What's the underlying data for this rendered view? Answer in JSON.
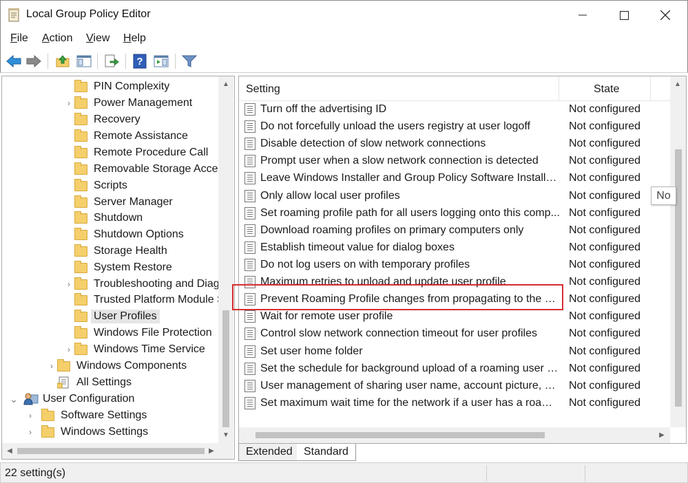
{
  "window": {
    "title": "Local Group Policy Editor"
  },
  "menu": {
    "items": [
      {
        "key": "F",
        "rest": "ile"
      },
      {
        "key": "A",
        "rest": "ction"
      },
      {
        "key": "V",
        "rest": "iew"
      },
      {
        "key": "H",
        "rest": "elp"
      }
    ]
  },
  "tree": {
    "items": [
      {
        "label": "PIN Complexity",
        "expander": false,
        "icon": "folder-icon"
      },
      {
        "label": "Power Management",
        "expander": true,
        "icon": "folder-icon"
      },
      {
        "label": "Recovery",
        "expander": false,
        "icon": "folder-icon"
      },
      {
        "label": "Remote Assistance",
        "expander": false,
        "icon": "folder-icon"
      },
      {
        "label": "Remote Procedure Call",
        "expander": false,
        "icon": "folder-icon"
      },
      {
        "label": "Removable Storage Access",
        "expander": false,
        "icon": "folder-icon"
      },
      {
        "label": "Scripts",
        "expander": false,
        "icon": "folder-icon"
      },
      {
        "label": "Server Manager",
        "expander": false,
        "icon": "folder-icon"
      },
      {
        "label": "Shutdown",
        "expander": false,
        "icon": "folder-icon"
      },
      {
        "label": "Shutdown Options",
        "expander": false,
        "icon": "folder-icon"
      },
      {
        "label": "Storage Health",
        "expander": false,
        "icon": "folder-icon"
      },
      {
        "label": "System Restore",
        "expander": false,
        "icon": "folder-icon"
      },
      {
        "label": "Troubleshooting and Diag",
        "expander": true,
        "icon": "folder-icon"
      },
      {
        "label": "Trusted Platform Module S",
        "expander": false,
        "icon": "folder-icon"
      },
      {
        "label": "User Profiles",
        "expander": false,
        "icon": "folder-icon",
        "selected": true
      },
      {
        "label": "Windows File Protection",
        "expander": false,
        "icon": "folder-icon"
      },
      {
        "label": "Windows Time Service",
        "expander": true,
        "icon": "folder-icon"
      },
      {
        "label": "Windows Components",
        "expander": true,
        "icon": "folder-icon"
      },
      {
        "label": "All Settings",
        "expander": false,
        "icon": "settings-list-icon"
      },
      {
        "label": "User Configuration",
        "expander": "open",
        "icon": "user-config-icon"
      },
      {
        "label": "Software Settings",
        "expander": true,
        "icon": "folder-icon"
      },
      {
        "label": "Windows Settings",
        "expander": true,
        "icon": "folder-icon"
      }
    ]
  },
  "list": {
    "headers": {
      "setting": "Setting",
      "state": "State"
    },
    "rows": [
      {
        "name": "Turn off the advertising ID",
        "state": "Not configured"
      },
      {
        "name": "Do not forcefully unload the users registry at user logoff",
        "state": "Not configured"
      },
      {
        "name": "Disable detection of slow network connections",
        "state": "Not configured"
      },
      {
        "name": "Prompt user when a slow network connection is detected",
        "state": "Not configured"
      },
      {
        "name": "Leave Windows Installer and Group Policy Software Installatio...",
        "state": "Not configured"
      },
      {
        "name": "Only allow local user profiles",
        "state": "Not configured"
      },
      {
        "name": "Set roaming profile path for all users logging onto this comp...",
        "state": "Not configured"
      },
      {
        "name": "Download roaming profiles on primary computers only",
        "state": "Not configured"
      },
      {
        "name": "Establish timeout value for dialog boxes",
        "state": "Not configured"
      },
      {
        "name": "Do not log users on with temporary profiles",
        "state": "Not configured"
      },
      {
        "name": "Maximum retries to unload and update user profile",
        "state": "Not configured"
      },
      {
        "name": "Prevent Roaming Profile changes from propagating to the se...",
        "state": "Not configured"
      },
      {
        "name": "Wait for remote user profile",
        "state": "Not configured"
      },
      {
        "name": "Control slow network connection timeout for user profiles",
        "state": "Not configured"
      },
      {
        "name": "Set user home folder",
        "state": "Not configured"
      },
      {
        "name": "Set the schedule for background upload of a roaming user pr...",
        "state": "Not configured"
      },
      {
        "name": "User management of sharing user name, account picture, and...",
        "state": "Not configured"
      },
      {
        "name": "Set maximum wait time for the network if a user has a roamin...",
        "state": "Not configured"
      }
    ],
    "tooltip": "No"
  },
  "tabs": {
    "extended": "Extended",
    "standard": "Standard"
  },
  "status": {
    "text": "22 setting(s)"
  },
  "colors": {
    "highlight": "#d52b30",
    "folder": "#f5cf6b",
    "selected": "#e5e5e5"
  }
}
